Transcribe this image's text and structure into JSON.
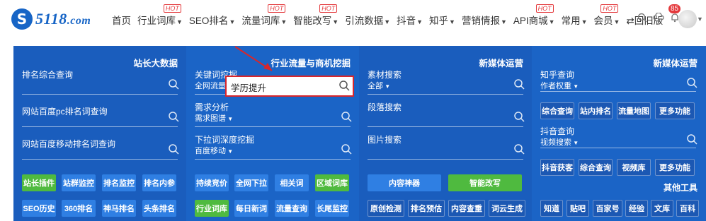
{
  "logo": {
    "mark": "S",
    "name": "5118",
    "suffix": ".com"
  },
  "nav": [
    {
      "label": "首页",
      "dropdown": false,
      "hot": ""
    },
    {
      "label": "行业词库",
      "dropdown": true,
      "hot": "HOT"
    },
    {
      "label": "SEO排名",
      "dropdown": true,
      "hot": ""
    },
    {
      "label": "流量词库",
      "dropdown": true,
      "hot": "HOT"
    },
    {
      "label": "智能改写",
      "dropdown": true,
      "hot": "HOT"
    },
    {
      "label": "引流数据",
      "dropdown": true,
      "hot": ""
    },
    {
      "label": "抖音",
      "dropdown": true,
      "hot": ""
    },
    {
      "label": "知乎",
      "dropdown": true,
      "hot": ""
    },
    {
      "label": "营销情报",
      "dropdown": true,
      "hot": ""
    },
    {
      "label": "API商城",
      "dropdown": true,
      "hot": "HOT"
    },
    {
      "label": "常用",
      "dropdown": true,
      "hot": ""
    },
    {
      "label": "会员",
      "dropdown": true,
      "hot": "HOT"
    },
    {
      "label": "⇄回旧版",
      "dropdown": false,
      "hot": ""
    }
  ],
  "notification_count": "85",
  "columns": [
    {
      "title": "站长大数据",
      "fields": [
        {
          "label": "排名综合查询",
          "sub": ""
        },
        {
          "label": "网站百度pc排名词查询",
          "sub": ""
        },
        {
          "label": "网站百度移动排名词查询",
          "sub": ""
        }
      ],
      "buttons": [
        {
          "label": "站长插件",
          "style": "green"
        },
        {
          "label": "站群监控",
          "style": "blue"
        },
        {
          "label": "排名监控",
          "style": "blue"
        },
        {
          "label": "排名内参",
          "style": "blue"
        },
        {
          "label": "SEO历史",
          "style": "blue"
        },
        {
          "label": "360排名",
          "style": "blue"
        },
        {
          "label": "神马排名",
          "style": "blue"
        },
        {
          "label": "头条排名",
          "style": "blue"
        }
      ]
    },
    {
      "title": "行业流量与商机挖掘",
      "fields": [
        {
          "label": "关键词挖掘",
          "sub": "全网流量词"
        },
        {
          "label": "需求分析",
          "sub": "需求图谱"
        },
        {
          "label": "下拉词深度挖掘",
          "sub": "百度移动"
        }
      ],
      "search_value": "学历提升",
      "buttons": [
        {
          "label": "持续竞价",
          "style": "blue"
        },
        {
          "label": "全网下拉",
          "style": "blue"
        },
        {
          "label": "相关词",
          "style": "blue"
        },
        {
          "label": "区域词库",
          "style": "green"
        },
        {
          "label": "行业词库",
          "style": "green"
        },
        {
          "label": "每日新词",
          "style": "blue"
        },
        {
          "label": "流量查询",
          "style": "blue"
        },
        {
          "label": "长尾监控",
          "style": "blue"
        }
      ]
    },
    {
      "title": "新媒体运营",
      "fields": [
        {
          "label": "素材搜索",
          "sub": "全部"
        },
        {
          "label": "段落搜索",
          "sub": ""
        },
        {
          "label": "图片搜索",
          "sub": ""
        }
      ],
      "buttons_wide": [
        {
          "label": "内容神器",
          "style": "blue"
        },
        {
          "label": "智能改写",
          "style": "green"
        }
      ],
      "buttons": [
        {
          "label": "原创检测",
          "style": "dark"
        },
        {
          "label": "排名预估",
          "style": "dark"
        },
        {
          "label": "内容查重",
          "style": "dark"
        },
        {
          "label": "词云生成",
          "style": "dark"
        }
      ]
    },
    {
      "title": "新媒体运营",
      "fields": [
        {
          "label": "知乎查询",
          "sub": "作者权重"
        },
        {
          "label": "抖音查询",
          "sub": "视频搜索"
        }
      ],
      "buttons_row1": [
        {
          "label": "综合查询"
        },
        {
          "label": "站内排名"
        },
        {
          "label": "流量地图"
        },
        {
          "label": "更多功能"
        }
      ],
      "buttons_row2": [
        {
          "label": "抖音获客"
        },
        {
          "label": "综合查询"
        },
        {
          "label": "视频库"
        },
        {
          "label": "更多功能"
        }
      ],
      "other_tools_title": "其他工具",
      "buttons_row3": [
        {
          "label": "知道"
        },
        {
          "label": "贴吧"
        },
        {
          "label": "百家号"
        },
        {
          "label": "经验"
        },
        {
          "label": "文库"
        },
        {
          "label": "百科"
        }
      ]
    }
  ],
  "colors": {
    "brand": "#1765c6",
    "panel": "#1a5dbd",
    "green": "#4fba3f",
    "highlight": "#d9262b"
  }
}
